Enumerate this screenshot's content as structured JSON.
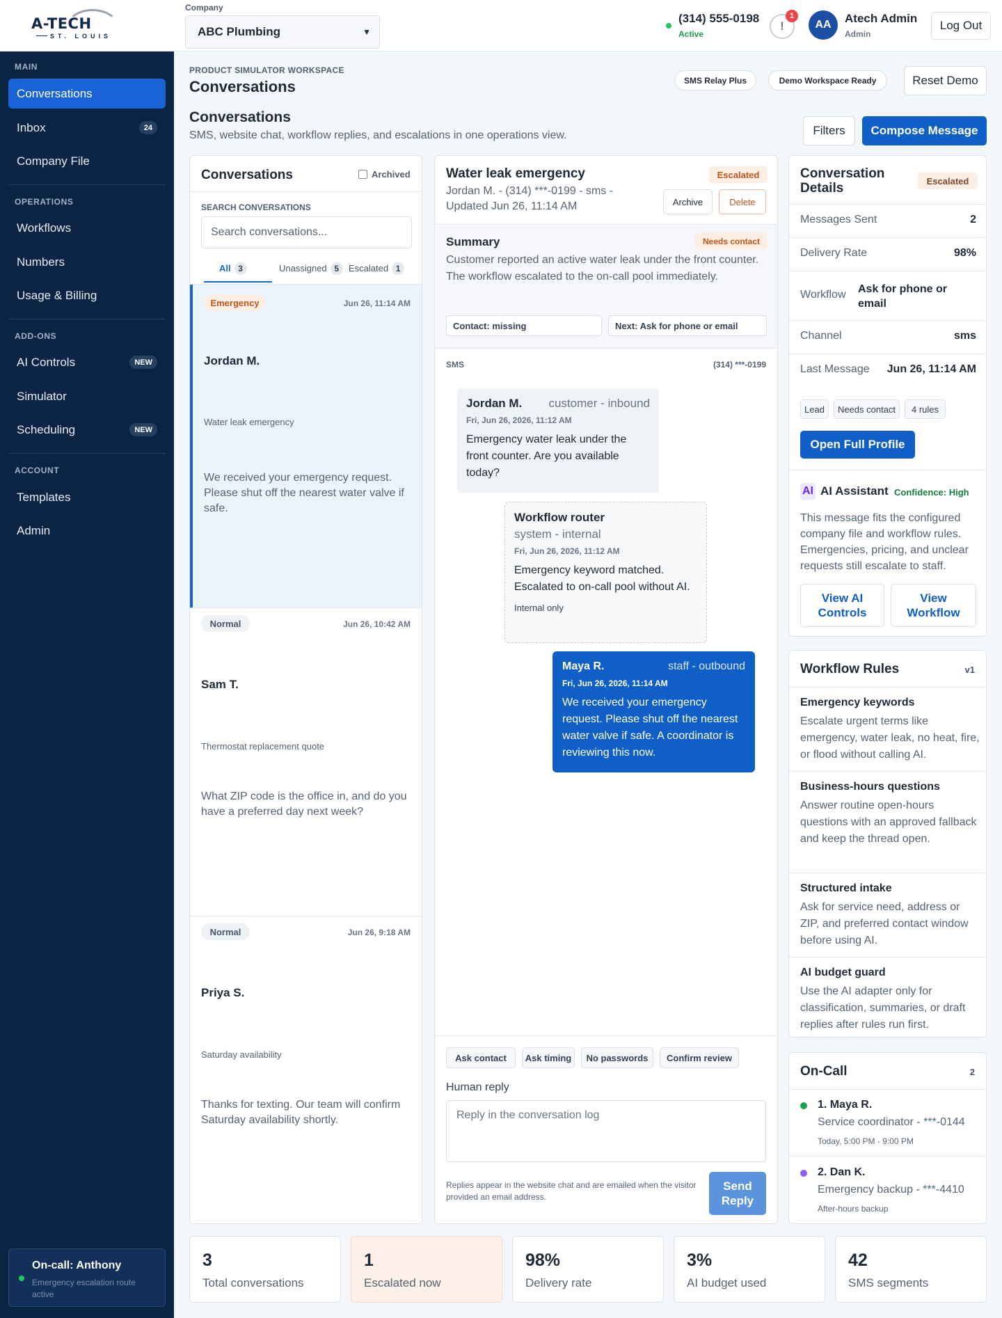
{
  "brand": {
    "logo_text": "A-TECH",
    "logo_sub": "ST. LOUIS"
  },
  "sidebar": {
    "sections": [
      {
        "label": "MAIN",
        "items": [
          {
            "label": "Conversations",
            "active": true
          },
          {
            "label": "Inbox",
            "badge": "24"
          },
          {
            "label": "Company File"
          }
        ]
      },
      {
        "label": "OPERATIONS",
        "items": [
          {
            "label": "Workflows"
          },
          {
            "label": "Numbers"
          },
          {
            "label": "Usage & Billing"
          }
        ]
      },
      {
        "label": "ADD-ONS",
        "items": [
          {
            "label": "AI Controls",
            "badge": "NEW"
          },
          {
            "label": "Simulator"
          },
          {
            "label": "Scheduling",
            "badge": "NEW"
          }
        ]
      },
      {
        "label": "ACCOUNT",
        "items": [
          {
            "label": "Templates"
          },
          {
            "label": "Admin"
          }
        ]
      }
    ],
    "oncall": {
      "title": "On-call: Anthony",
      "subtitle": "Emergency escalation route active"
    }
  },
  "topbar": {
    "company_label": "Company",
    "company_value": "ABC Plumbing",
    "phone": "(314) 555-0198",
    "phone_status": "Active",
    "alert_icon": "!",
    "alert_count": "1",
    "avatar_initials": "AA",
    "user_name": "Atech Admin",
    "user_role": "Admin",
    "logout_label": "Log Out"
  },
  "workspace": {
    "kicker": "PRODUCT SIMULATOR WORKSPACE",
    "title": "Conversations",
    "pill_sms": "SMS Relay Plus",
    "pill_demo": "Demo Workspace Ready",
    "reset_label": "Reset Demo"
  },
  "section": {
    "title": "Conversations",
    "subtitle": "SMS, website chat, workflow replies, and escalations in one operations view.",
    "filters_label": "Filters",
    "compose_label": "Compose Message"
  },
  "list": {
    "title": "Conversations",
    "archived_label": "Archived",
    "search_label": "SEARCH CONVERSATIONS",
    "search_placeholder": "Search conversations...",
    "tabs": [
      {
        "label": "All",
        "count": "3"
      },
      {
        "label": "Unassigned",
        "count": "5"
      },
      {
        "label": "Escalated",
        "count": "1"
      }
    ],
    "items": [
      {
        "priority": "Emergency",
        "date": "Jun 26, 11:14 AM",
        "name": "Jordan M.",
        "subject": "Water leak emergency",
        "preview": "We received your emergency request. Please shut off the nearest water valve if safe."
      },
      {
        "priority": "Normal",
        "date": "Jun 26, 10:42 AM",
        "name": "Sam T.",
        "subject": "Thermostat replacement quote",
        "preview": "What ZIP code is the office in, and do you have a preferred day next week?"
      },
      {
        "priority": "Normal",
        "date": "Jun 26, 9:18 AM",
        "name": "Priya S.",
        "subject": "Saturday availability",
        "preview": "Thanks for texting. Our team will confirm Saturday availability shortly."
      }
    ]
  },
  "thread": {
    "title": "Water leak emergency",
    "status": "Escalated",
    "meta": "Jordan M. - (314) ***-0199 - sms -",
    "updated": "Updated Jun 26, 11:14 AM",
    "archive_label": "Archive",
    "delete_label": "Delete",
    "summary_title": "Summary",
    "summary_tag": "Needs contact",
    "summary_text": "Customer reported an active water leak under the front counter. The workflow escalated to the on-call pool immediately.",
    "contact_chip": "Contact: missing",
    "next_chip": "Next: Ask for phone or email",
    "channel": "SMS",
    "channel_number": "(314) ***-0199",
    "messages": [
      {
        "who": "Jordan M.",
        "meta": "customer - inbound",
        "date": "Fri, Jun 26, 2026, 11:12 AM",
        "text": "Emergency water leak under the front counter. Are you available today?"
      },
      {
        "who": "Workflow router",
        "meta": "system - internal",
        "date": "Fri, Jun 26, 2026, 11:12 AM",
        "text": "Emergency keyword matched. Escalated to on-call pool without AI.",
        "note": "Internal only"
      },
      {
        "who": "Maya R.",
        "meta": "staff - outbound",
        "date": "Fri, Jun 26, 2026, 11:14 AM",
        "text": "We received your emergency request. Please shut off the nearest water valve if safe. A coordinator is reviewing this now."
      }
    ],
    "quick": [
      "Ask contact",
      "Ask timing",
      "No passwords",
      "Confirm review"
    ],
    "reply_label": "Human reply",
    "reply_placeholder": "Reply in the conversation log",
    "reply_hint": "Replies appear in the website chat and are emailed when the visitor provided an email address.",
    "send_label": "Send Reply"
  },
  "details": {
    "title": "Conversation Details",
    "status": "Escalated",
    "rows": [
      {
        "k": "Messages Sent",
        "v": "2"
      },
      {
        "k": "Delivery Rate",
        "v": "98%"
      },
      {
        "k": "Workflow",
        "v": "Ask for phone or email"
      },
      {
        "k": "Channel",
        "v": "sms"
      },
      {
        "k": "Last Message",
        "v": "Jun 26, 11:14 AM"
      }
    ],
    "tags": [
      "Lead",
      "Needs contact",
      "4 rules"
    ],
    "open_profile": "Open Full Profile",
    "ai_badge": "AI",
    "ai_title": "AI Assistant",
    "ai_confidence": "Confidence: High",
    "ai_text": "This message fits the configured company file and workflow rules. Emergencies, pricing, and unclear requests still escalate to staff.",
    "view_ai": "View AI Controls",
    "view_workflow": "View Workflow"
  },
  "rules": {
    "title": "Workflow Rules",
    "version": "v1",
    "items": [
      {
        "t": "Emergency keywords",
        "d": "Escalate urgent terms like emergency, water leak, no heat, fire, or flood without calling AI."
      },
      {
        "t": "Business-hours questions",
        "d": "Answer routine open-hours questions with an approved fallback and keep the thread open."
      },
      {
        "t": "Structured intake",
        "d": "Ask for service need, address or ZIP, and preferred contact window before using AI."
      },
      {
        "t": "AI budget guard",
        "d": "Use the AI adapter only for classification, summaries, or draft replies after rules run first."
      }
    ]
  },
  "oncall_panel": {
    "title": "On-Call",
    "count": "2",
    "people": [
      {
        "name": "1. Maya R.",
        "role": "Service coordinator - ***-0144",
        "time": "Today, 5:00 PM - 9:00 PM",
        "color": "#16a34a"
      },
      {
        "name": "2. Dan K.",
        "role": "Emergency backup - ***-4410",
        "time": "After-hours backup",
        "color": "#8b5cf6"
      }
    ]
  },
  "stats": [
    {
      "n": "3",
      "l": "Total conversations"
    },
    {
      "n": "1",
      "l": "Escalated now"
    },
    {
      "n": "98%",
      "l": "Delivery rate"
    },
    {
      "n": "3%",
      "l": "AI budget used"
    },
    {
      "n": "42",
      "l": "SMS segments"
    }
  ]
}
